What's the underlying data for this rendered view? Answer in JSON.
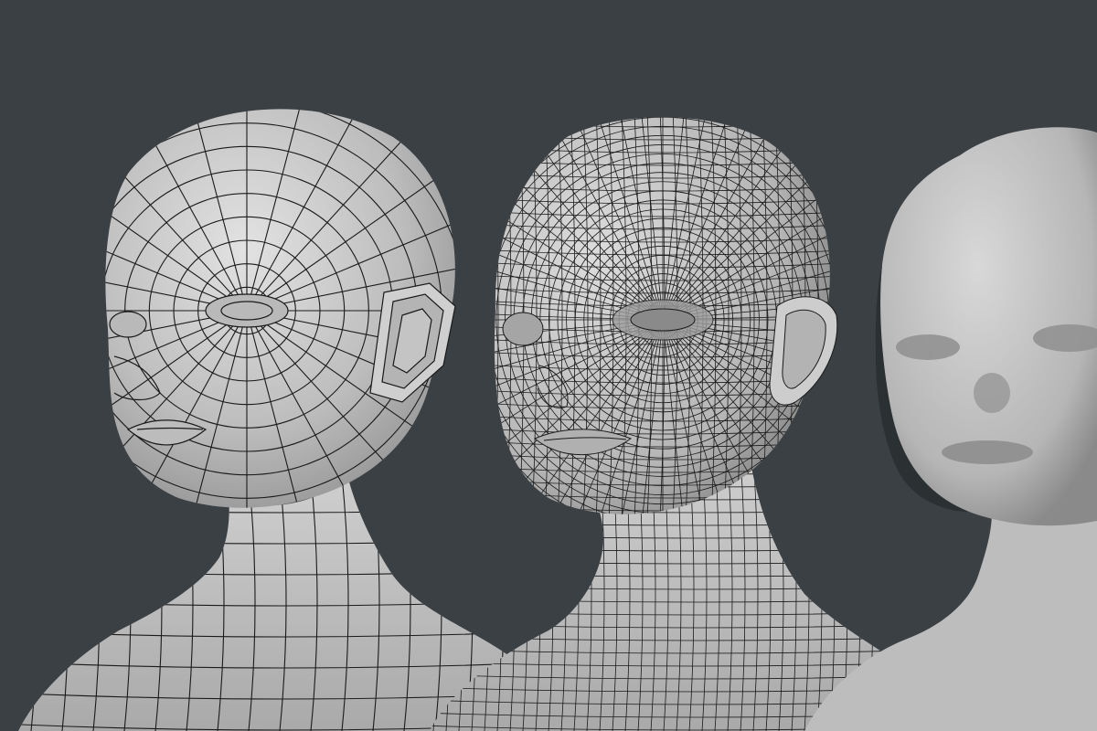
{
  "scene": {
    "background_color": "#3b4044",
    "surface_color": "#c8c8c8",
    "wire_color": "#1a1a1a",
    "models": [
      {
        "name": "low-poly-head",
        "wireframe": true,
        "density": "low"
      },
      {
        "name": "subdivided-head",
        "wireframe": true,
        "density": "high"
      },
      {
        "name": "smooth-head",
        "wireframe": false,
        "density": "none"
      }
    ]
  }
}
